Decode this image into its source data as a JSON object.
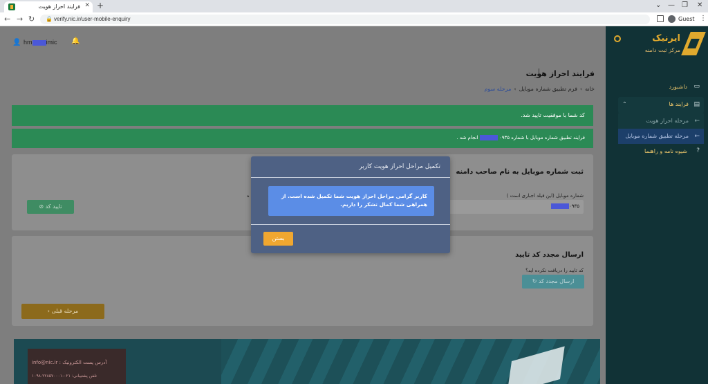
{
  "browser": {
    "tab_title": "فرایند احراز هویت",
    "url": "verify.nic.ir/user-mobile-enquiry",
    "guest_label": "Guest"
  },
  "header": {
    "username_prefix": "hm",
    "username_suffix": "imic"
  },
  "page": {
    "title": "فرایند احراز هویت",
    "breadcrumb": [
      "خانه",
      "فرم تطبیق شماره موبایل",
      "مرحله سوم"
    ]
  },
  "alerts": [
    {
      "text": "کد شما با موفقیت تایید شد."
    },
    {
      "text_before": "فرایند تطبیق شماره موبایل با شماره ۰۹۳۵",
      "text_after": "انجام شد ."
    }
  ],
  "card1": {
    "title": "ثبت شماره موبایل به نام صاحب دامنه",
    "title_partial": "د",
    "field_label": "شماره موبایل (این فیلد اجباری است )",
    "field_value_prefix": "۰۹۳۵",
    "field_label_partial": "ه",
    "confirm_label": "تایید کد"
  },
  "card2": {
    "title": "ارسال مجدد کد تایید",
    "hint": "کد تایید را دریافت نکرده اید؟",
    "resend_label": "ارسال مجدد کد",
    "prev_label": "مرحله قبلی"
  },
  "footer": {
    "email": "آدرس پست الکترونیک : info@nic.ir",
    "phone": "تلفن پشتیبانی: ۰۲۱-۲۲۸۵۷۰۰۰۱-۱۰۹۸"
  },
  "sidebar": {
    "logo_name": "ایرنیک",
    "logo_sub": "مرکز ثبت دامنه",
    "items": {
      "dashboard": "داشبورد",
      "processes": "فرایند ها",
      "step_verify": "مرحله احراز هویت",
      "step_mobile": "مرحله تطبیق شماره موبایل",
      "guide": "شیوه نامه و راهنما"
    }
  },
  "modal": {
    "title": "تکمیل مراحل احراز هویت کاربر",
    "message": "کاربر گرامی مراحل احراز هویت شما تکمیل شده است. از همراهی شما کمال تشکر را داریم.",
    "close_label": "بستن"
  }
}
